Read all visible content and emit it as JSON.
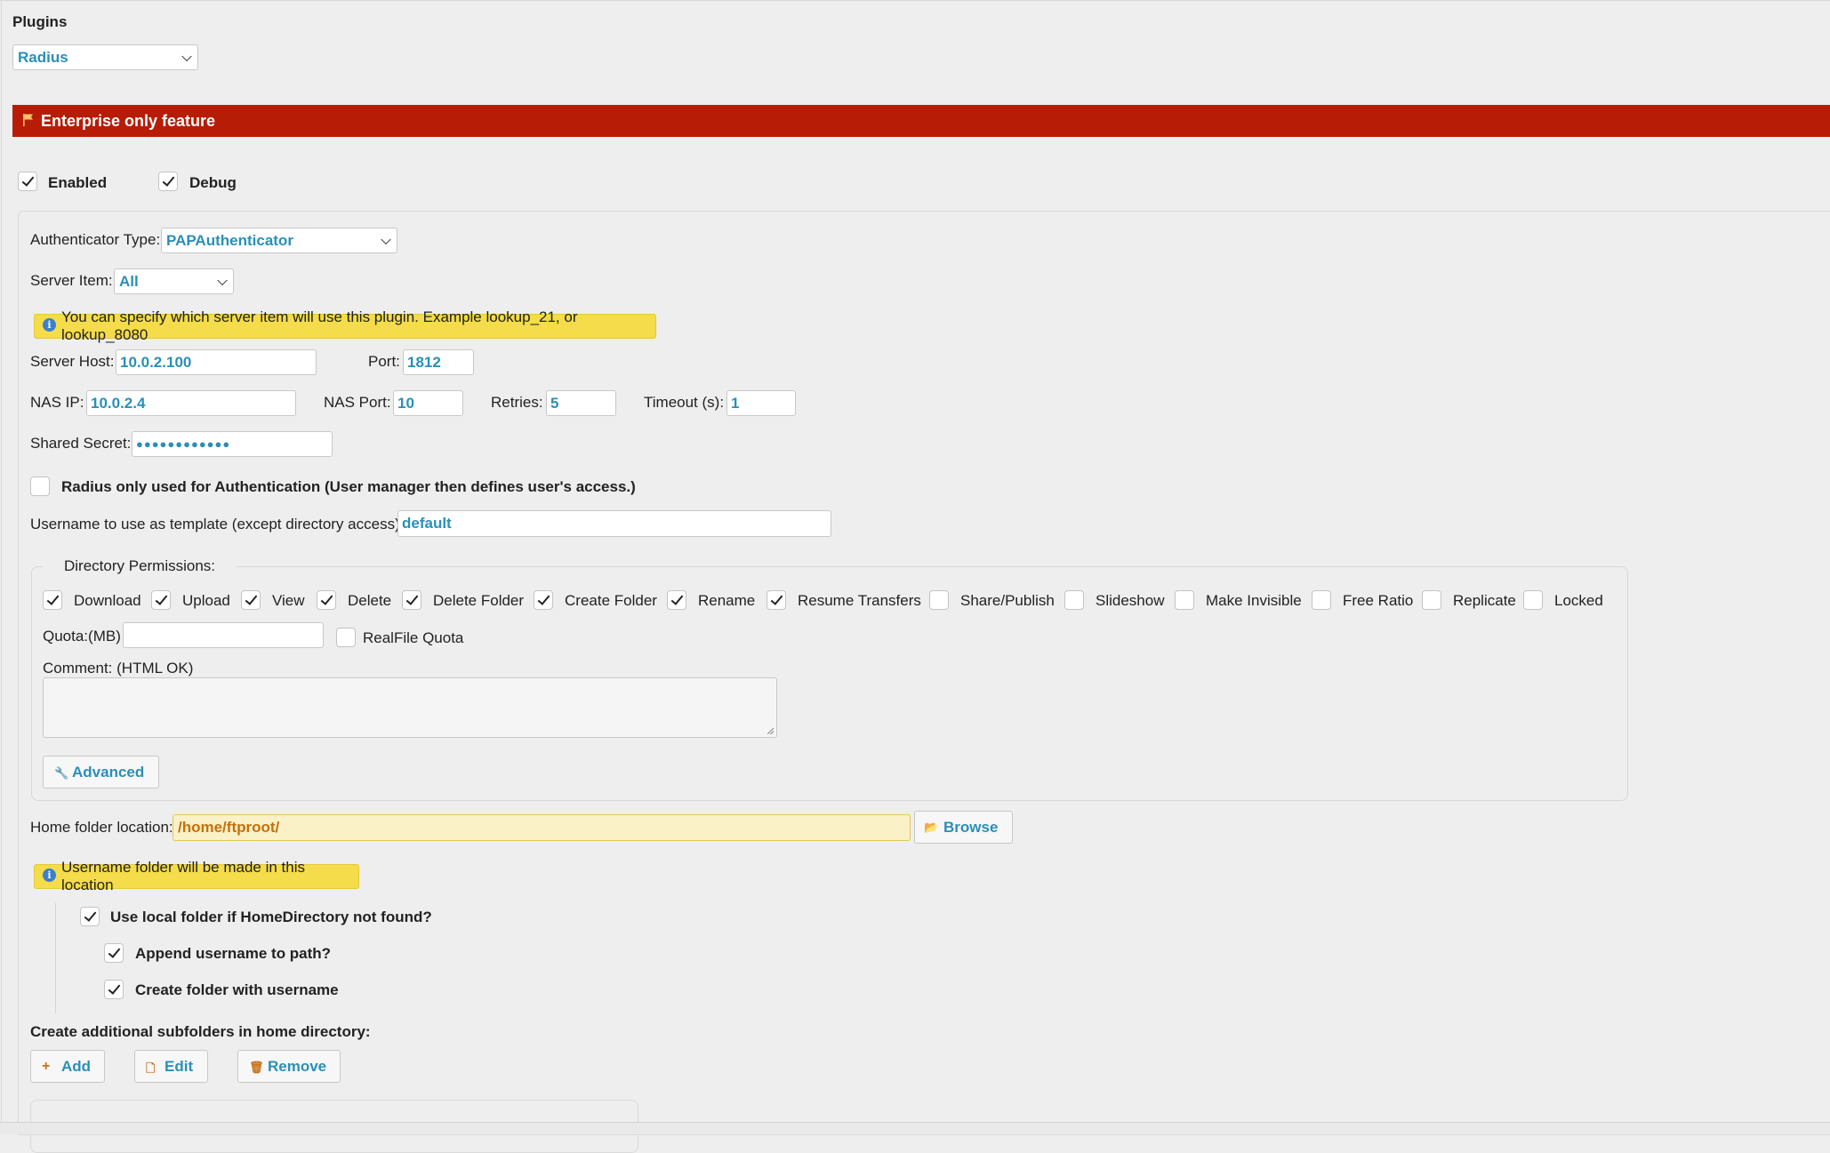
{
  "header": {
    "title": "Plugins",
    "plugin_select": "Radius"
  },
  "banner": {
    "text": "Enterprise only feature"
  },
  "toggles": {
    "enabled_label": "Enabled",
    "debug_label": "Debug"
  },
  "auth": {
    "type_label": "Authenticator Type:",
    "type_value": "PAPAuthenticator",
    "server_item_label": "Server Item:",
    "server_item_value": "All",
    "server_item_note": "You can specify which server item will use this plugin. Example lookup_21, or lookup_8080"
  },
  "server": {
    "host_label": "Server Host:",
    "host_value": "10.0.2.100",
    "port_label": "Port:",
    "port_value": "1812",
    "nas_ip_label": "NAS IP:",
    "nas_ip_value": "10.0.2.4",
    "nas_port_label": "NAS Port:",
    "nas_port_value": "10",
    "retries_label": "Retries:",
    "retries_value": "5",
    "timeout_label": "Timeout (s):",
    "timeout_value": "1",
    "secret_label": "Shared Secret:",
    "secret_value": "●●●●●●●●●●●●"
  },
  "radius_only_label": "Radius only used for Authentication (User manager then defines user's access.)",
  "template": {
    "label": "Username to use as template (except directory access):",
    "value": "default"
  },
  "permissions": {
    "legend": "Directory Permissions:",
    "items": [
      {
        "label": "Download",
        "checked": true
      },
      {
        "label": "Upload",
        "checked": true
      },
      {
        "label": "View",
        "checked": true
      },
      {
        "label": "Delete",
        "checked": true
      },
      {
        "label": "Delete Folder",
        "checked": true
      },
      {
        "label": "Create Folder",
        "checked": true
      },
      {
        "label": "Rename",
        "checked": true
      },
      {
        "label": "Resume Transfers",
        "checked": true
      },
      {
        "label": "Share/Publish",
        "checked": false
      },
      {
        "label": "Slideshow",
        "checked": false
      },
      {
        "label": "Make Invisible",
        "checked": false
      },
      {
        "label": "Free Ratio",
        "checked": false
      },
      {
        "label": "Replicate",
        "checked": false
      },
      {
        "label": "Locked",
        "checked": false
      }
    ],
    "quota_label": "Quota:(MB)",
    "quota_value": "",
    "realfile_label": "RealFile Quota",
    "comment_label": "Comment: (HTML OK)",
    "advanced_label": "Advanced"
  },
  "home": {
    "label": "Home folder location:",
    "value": "/home/ftproot/",
    "browse_label": "Browse",
    "note": "Username folder will be made in this location",
    "use_local_label": "Use local folder if HomeDirectory not found?",
    "append_label": "Append username to path?",
    "create_label": "Create folder with username"
  },
  "subfolders": {
    "label": "Create additional subfolders in home directory:",
    "add_label": "Add",
    "edit_label": "Edit",
    "remove_label": "Remove"
  },
  "colors": {
    "banner": "#b71c07",
    "accent": "#2a8fb8",
    "note": "#f4dc4a"
  }
}
